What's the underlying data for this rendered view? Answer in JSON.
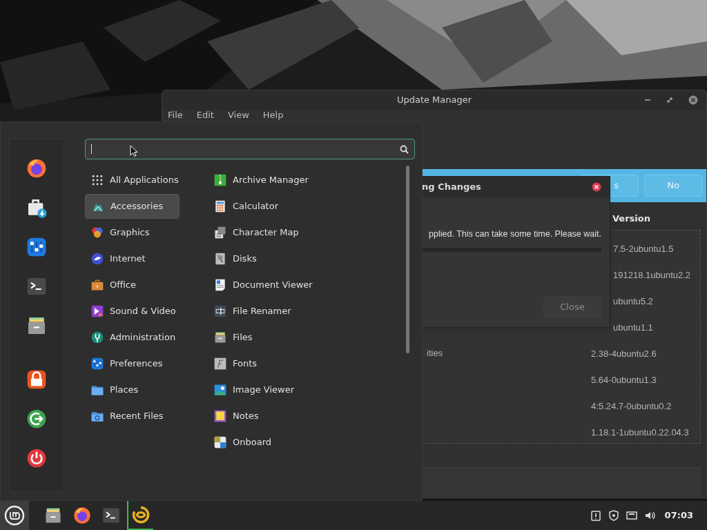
{
  "update_window": {
    "title": "Update Manager",
    "menu": [
      "File",
      "Edit",
      "View",
      "Help"
    ],
    "banner_buttons": [
      "s",
      "No"
    ],
    "table": {
      "header": "Version",
      "rows": [
        {
          "version": "7.5-2ubuntu1.5"
        },
        {
          "version": "191218.1ubuntu2.2"
        },
        {
          "version": "ubuntu5.2"
        },
        {
          "version": "ubuntu1.1"
        },
        {
          "name": "ities",
          "version": "2.38-4ubuntu2.6"
        },
        {
          "version": "5.64-0ubuntu1.3"
        },
        {
          "version": "4:5.24.7-0ubuntu0.2"
        },
        {
          "version": "1.18.1-1ubuntu0.22.04.3"
        }
      ]
    }
  },
  "dialog": {
    "title": "ng Changes",
    "message": "pplied. This can take some time. Please wait.",
    "button": {
      "label": "Close",
      "disabled": true
    }
  },
  "app_menu": {
    "favorites": [
      {
        "kind": "firefox"
      },
      {
        "kind": "store"
      },
      {
        "kind": "settings"
      },
      {
        "kind": "terminal"
      },
      {
        "kind": "files"
      },
      {
        "kind": "lock"
      },
      {
        "kind": "logout"
      },
      {
        "kind": "power"
      }
    ],
    "categories": [
      {
        "label": "All Applications",
        "kind": "all",
        "selected": false
      },
      {
        "label": "Accessories",
        "kind": "accessories",
        "selected": true
      },
      {
        "label": "Graphics",
        "kind": "graphics",
        "selected": false
      },
      {
        "label": "Internet",
        "kind": "internet",
        "selected": false
      },
      {
        "label": "Office",
        "kind": "office",
        "selected": false
      },
      {
        "label": "Sound & Video",
        "kind": "sound",
        "selected": false
      },
      {
        "label": "Administration",
        "kind": "admin",
        "selected": false
      },
      {
        "label": "Preferences",
        "kind": "prefs",
        "selected": false
      },
      {
        "label": "Places",
        "kind": "places",
        "selected": false
      },
      {
        "label": "Recent Files",
        "kind": "recent",
        "selected": false
      }
    ],
    "apps": [
      {
        "label": "Archive Manager",
        "kind": "archive"
      },
      {
        "label": "Calculator",
        "kind": "calculator"
      },
      {
        "label": "Character Map",
        "kind": "charmap"
      },
      {
        "label": "Disks",
        "kind": "disks"
      },
      {
        "label": "Document Viewer",
        "kind": "docviewer"
      },
      {
        "label": "File Renamer",
        "kind": "renamer"
      },
      {
        "label": "Files",
        "kind": "files"
      },
      {
        "label": "Fonts",
        "kind": "fonts"
      },
      {
        "label": "Image Viewer",
        "kind": "imageviewer"
      },
      {
        "label": "Notes",
        "kind": "notes"
      },
      {
        "label": "Onboard",
        "kind": "onboard"
      }
    ]
  },
  "taskbar": {
    "apps": [
      {
        "kind": "files",
        "active": false
      },
      {
        "kind": "firefox",
        "active": false
      },
      {
        "kind": "terminal",
        "active": false
      },
      {
        "kind": "update",
        "active": true
      }
    ],
    "clock": "07:03"
  }
}
